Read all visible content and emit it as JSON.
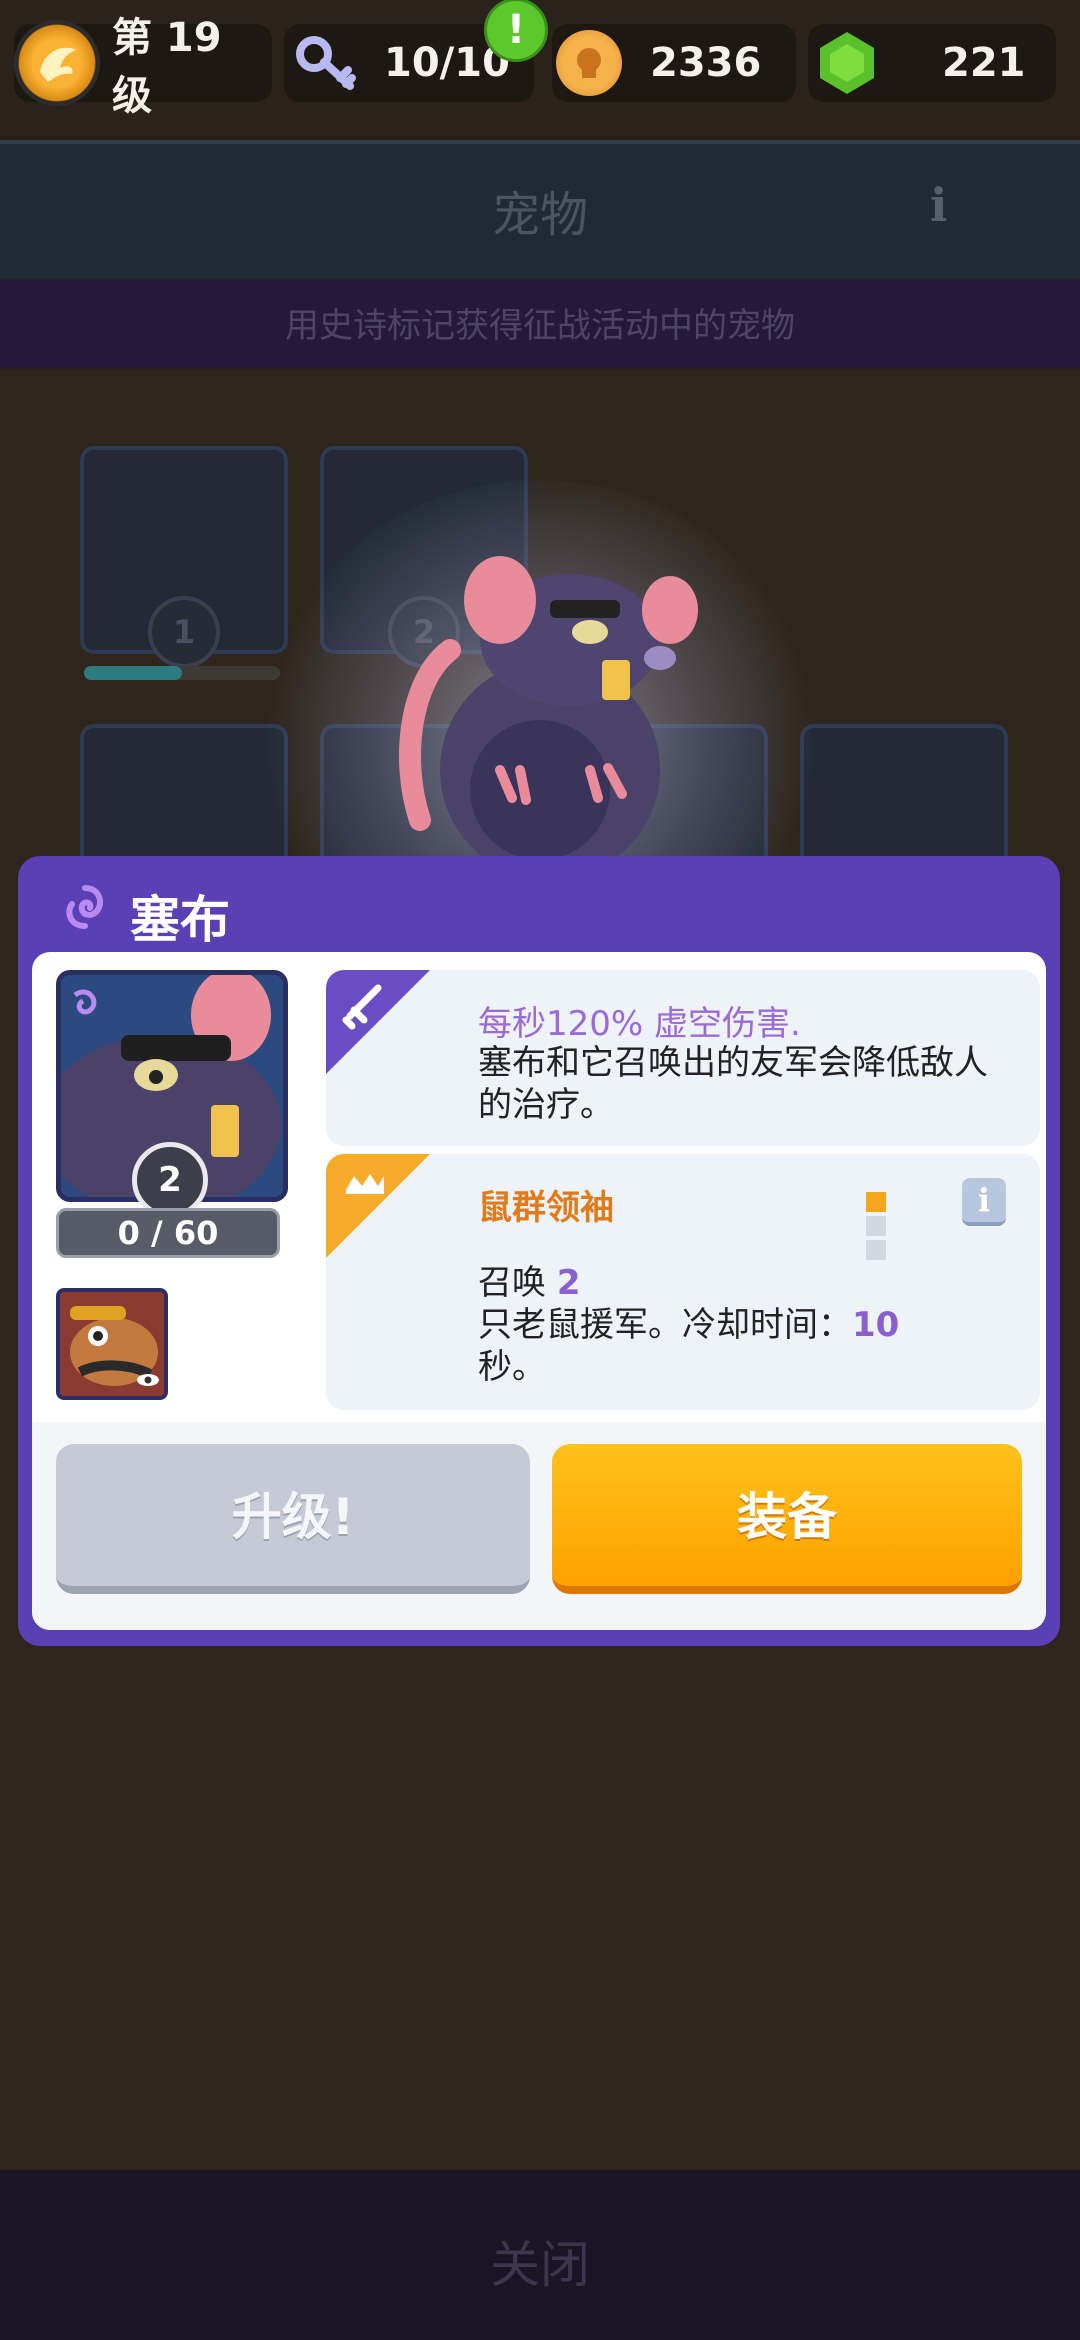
{
  "top_bar": {
    "level_text": "第 19 级",
    "keys": "10/10",
    "coins": "2336",
    "gems": "221",
    "alert_icon": "exclamation"
  },
  "background_page": {
    "title": "宠物",
    "info_label": "i",
    "banner": "用史诗标记获得征战活动中的宠物",
    "pet_levels": [
      "1",
      "2"
    ],
    "close_label": "关闭"
  },
  "modal": {
    "pet_name": "塞布",
    "pet_level": "2",
    "progress": "0 / 60",
    "skill1": {
      "line1": "每秒120% 虚空伤害.",
      "line2": "塞布和它召唤出的友军会降低敌人的治疗。"
    },
    "skill2": {
      "name": "鼠群领袖",
      "rank_filled": 1,
      "rank_total": 3,
      "info_label": "i",
      "desc_prefix": "召唤 ",
      "desc_num": "2",
      "desc_mid": "只老鼠援军。冷却时间：",
      "desc_num2": "10",
      "desc_suffix": "秒。"
    },
    "upgrade_label": "升级!",
    "equip_label": "装备"
  },
  "colors": {
    "modal_purple": "#5b3fb5",
    "equip_orange": "#ffa100",
    "skill_purple": "#9b6ad6",
    "skill_orange": "#e07b1a"
  }
}
